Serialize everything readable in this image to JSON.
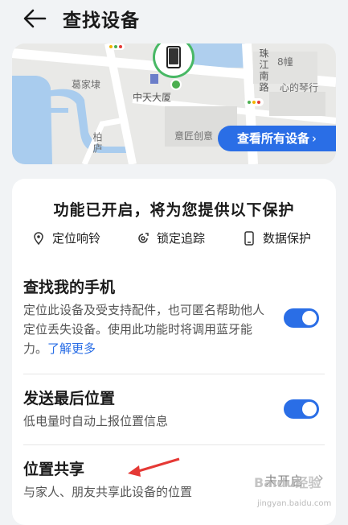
{
  "header": {
    "title": "查找设备"
  },
  "map": {
    "labels": {
      "zhujiang_road": "珠江南路",
      "building8": "8幢",
      "xindenglou": "心的琴行",
      "zhongtian": "中天大厦",
      "jiajia": "葛家埭",
      "yijiang": "意匠创意",
      "baihe": "柏庐"
    },
    "view_all_label": "查看所有设备"
  },
  "card": {
    "protection_title": "功能已开启，将为您提供以下保护",
    "features": [
      {
        "icon": "location-pin-icon",
        "label": "定位响铃"
      },
      {
        "icon": "lock-track-icon",
        "label": "锁定追踪"
      },
      {
        "icon": "phone-data-icon",
        "label": "数据保护"
      }
    ],
    "find_phone": {
      "title": "查找我的手机",
      "desc": "定位此设备及受支持配件，也可匿名帮助他人定位丢失设备。使用此功能时将调用蓝牙能力。",
      "learn_more": "了解更多",
      "enabled": true
    },
    "send_last": {
      "title": "发送最后位置",
      "desc": "低电量时自动上报位置信息",
      "enabled": true
    },
    "location_share": {
      "title": "位置共享",
      "desc": "与家人、朋友共享此设备的位置",
      "status": "未开启"
    }
  },
  "colors": {
    "accent": "#2a6ee6",
    "pin": "#48b865"
  },
  "watermark": {
    "logo": "Baidu经验",
    "url": "jingyan.baidu.com"
  }
}
